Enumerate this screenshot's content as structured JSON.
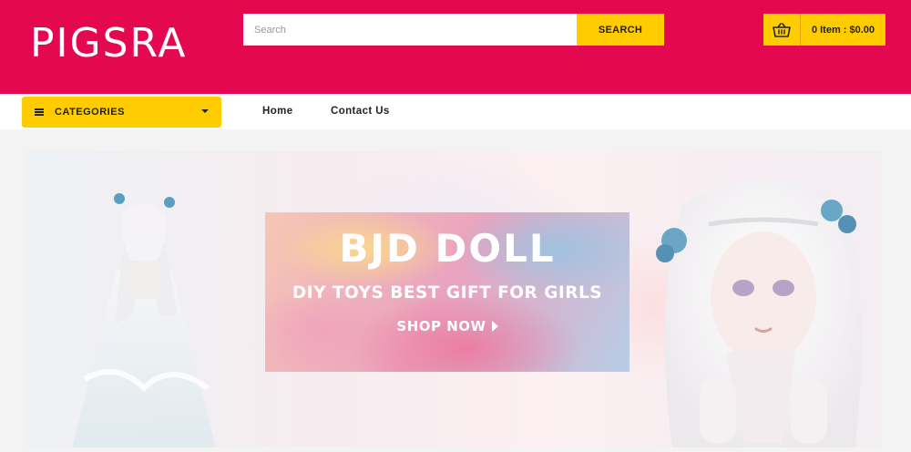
{
  "brand": {
    "logo": "PIGSRA"
  },
  "search": {
    "placeholder": "Search",
    "button_label": "SEARCH"
  },
  "cart": {
    "label": "0 Item : $0.00",
    "icon": "basket-icon"
  },
  "navbar": {
    "categories_label": "CATEGORIES",
    "links": [
      {
        "label": "Home"
      },
      {
        "label": "Contact Us"
      }
    ]
  },
  "hero": {
    "title": "BJD DOLL",
    "subtitle": "DIY TOYS BEST GIFT FOR GIRLS",
    "cta": "SHOP NOW"
  },
  "colors": {
    "brand": "#e3084f",
    "accent": "#ffcc00",
    "text": "#222222"
  }
}
